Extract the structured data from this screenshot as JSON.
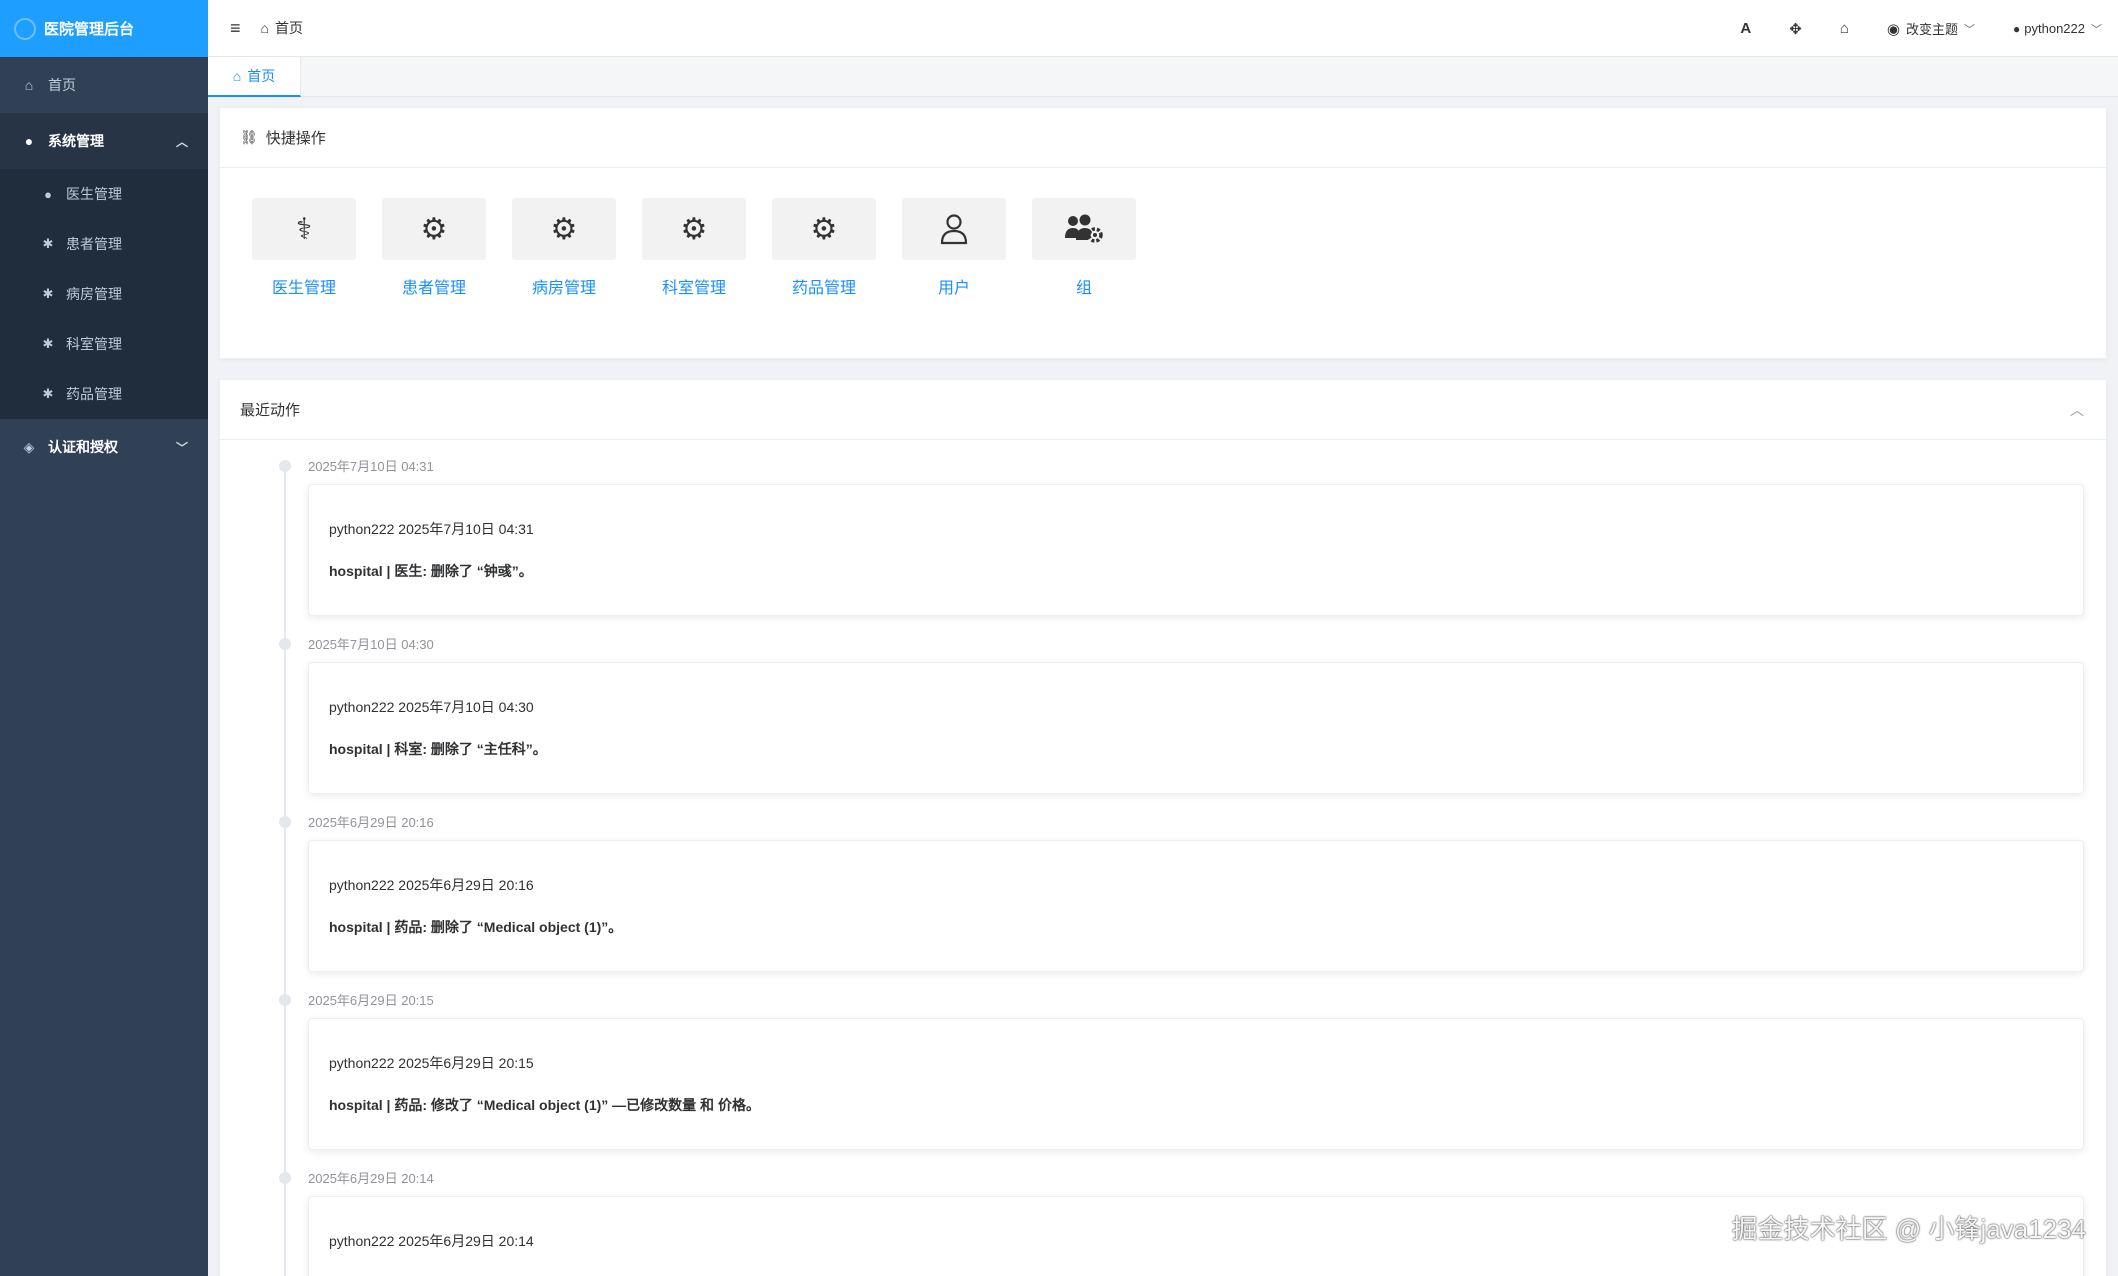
{
  "app": {
    "title": "医院管理后台"
  },
  "sidebar": {
    "home": "首页",
    "system": {
      "label": "系统管理",
      "items": [
        "医生管理",
        "患者管理",
        "病房管理",
        "科室管理",
        "药品管理"
      ]
    },
    "auth": {
      "label": "认证和授权"
    }
  },
  "header": {
    "breadcrumb": "首页",
    "theme": "改变主题",
    "user": "python222"
  },
  "tabs": [
    "首页"
  ],
  "quick": {
    "title": "快捷操作",
    "items": [
      {
        "label": "医生管理",
        "icon": "user-doctor-icon"
      },
      {
        "label": "患者管理",
        "icon": "gear-icon"
      },
      {
        "label": "病房管理",
        "icon": "gear-icon"
      },
      {
        "label": "科室管理",
        "icon": "gear-icon"
      },
      {
        "label": "药品管理",
        "icon": "gear-icon"
      },
      {
        "label": "用户",
        "icon": "user-icon"
      },
      {
        "label": "组",
        "icon": "users-gear-icon"
      }
    ]
  },
  "recent": {
    "title": "最近动作",
    "items": [
      {
        "time": "2025年7月10日 04:31",
        "meta": "python222 2025年7月10日 04:31",
        "msg": "hospital | 医生: 删除了 “钟彧”。"
      },
      {
        "time": "2025年7月10日 04:30",
        "meta": "python222 2025年7月10日 04:30",
        "msg": "hospital | 科室: 删除了 “主任科”。"
      },
      {
        "time": "2025年6月29日 20:16",
        "meta": "python222 2025年6月29日 20:16",
        "msg": "hospital | 药品: 删除了 “Medical object (1)”。"
      },
      {
        "time": "2025年6月29日 20:15",
        "meta": "python222 2025年6月29日 20:15",
        "msg": "hospital | 药品: 修改了 “Medical object (1)” —已修改数量 和 价格。"
      },
      {
        "time": "2025年6月29日 20:14",
        "meta": "python222 2025年6月29日 20:14",
        "msg": ""
      }
    ]
  },
  "watermark": "掘金技术社区 @ 小锋java1234"
}
